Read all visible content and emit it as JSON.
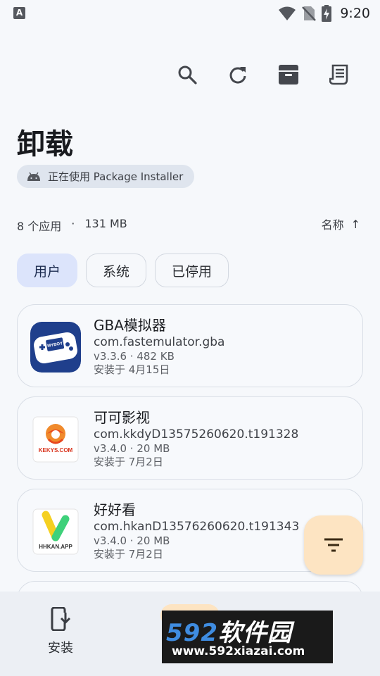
{
  "status_bar": {
    "notification_letter": "A",
    "time": "9:20"
  },
  "toolbar": {
    "icons": [
      "search-icon",
      "refresh-icon",
      "archive-icon",
      "receipt-icon"
    ]
  },
  "page": {
    "title": "卸载"
  },
  "installer": {
    "text": "正在使用 Package Installer"
  },
  "summary": {
    "count": "8 个应用",
    "separator": "·",
    "size": "131 MB"
  },
  "sort": {
    "label": "名称",
    "arrow": "↑"
  },
  "filters": [
    {
      "label": "用户",
      "active": true
    },
    {
      "label": "系统",
      "active": false
    },
    {
      "label": "已停用",
      "active": false
    }
  ],
  "apps": [
    {
      "name": "GBA模拟器",
      "package": "com.fastemulator.gba",
      "version": "v3.3.6 · 482 KB",
      "installed": "安装于 4月15日",
      "icon_text": "MYBOY"
    },
    {
      "name": "可可影视",
      "package": "com.kkdyD13575260620.t191328",
      "version": "v3.4.0 · 20 MB",
      "installed": "安装于 7月2日",
      "icon_text": "KEKYS.COM"
    },
    {
      "name": "好好看",
      "package": "com.hkanD13576260620.t191343",
      "version": "v3.4.0 · 20 MB",
      "installed": "安装于 7月2日",
      "icon_text": "HHKAN.APP"
    }
  ],
  "bottom_nav": {
    "install_label": "安装"
  },
  "watermark": {
    "number": "592",
    "cn": "软件园",
    "url": "www.592xiazai.com"
  },
  "colors": {
    "accent_chip": "#dce4fb",
    "fab": "#fde4c2",
    "background": "#f6f8fb"
  }
}
